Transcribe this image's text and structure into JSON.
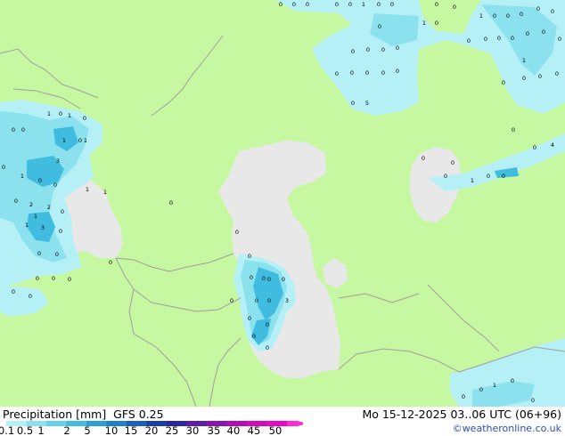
{
  "title": {
    "label": "Precipitation [mm]",
    "model": "GFS 0.25"
  },
  "datetime": "Mo 15-12-2025 03..06 UTC (06+96)",
  "credit": "©weatheronline.co.uk",
  "legend": {
    "ticks": [
      "0.1",
      "0.5",
      "1",
      "2",
      "5",
      "10",
      "15",
      "20",
      "25",
      "30",
      "35",
      "40",
      "45",
      "50"
    ],
    "colors": [
      "#b4f0f5",
      "#8be2ee",
      "#64d2e8",
      "#3fbcdf",
      "#2aa0d6",
      "#1e82c8",
      "#1a5fb8",
      "#1a3fa8",
      "#2e25a0",
      "#5c1ea8",
      "#8a14b0",
      "#b40cb4",
      "#d20cbe",
      "#e60ac8",
      "#ff28d2"
    ]
  },
  "colors": {
    "land": "#c6f7a1",
    "water": "#e8e8e8",
    "precip_light": "#b4f0f5",
    "precip_mid": "#8be2ee",
    "precip_heavy": "#3fbcdf",
    "border": "#a0a0a0"
  },
  "precip_values": [
    "0",
    "0",
    "0",
    "0",
    "0",
    "1",
    "0",
    "0",
    "0",
    "0",
    "1",
    "0",
    "0",
    "0",
    "0",
    "0",
    "0",
    "1",
    "0",
    "0",
    "0",
    "0",
    "0",
    "0",
    "0",
    "0",
    "0",
    "0",
    "0",
    "0",
    "0",
    "0",
    "0",
    "0",
    "0",
    "1",
    "0",
    "0",
    "0",
    "0",
    "1",
    "0",
    "1",
    "0",
    "0",
    "0",
    "3",
    "1",
    "0",
    "1",
    "0",
    "1",
    "0",
    "0",
    "1",
    "1",
    "2",
    "0",
    "1",
    "2",
    "0",
    "1",
    "3",
    "0",
    "0",
    "0",
    "0",
    "0",
    "0",
    "0",
    "0",
    "3",
    "0",
    "0",
    "0",
    "0",
    "5",
    "0",
    "0",
    "0",
    "4",
    "1",
    "0",
    "0",
    "0",
    "0",
    "0",
    "0",
    "0",
    "0",
    "0",
    "0",
    "0",
    "0",
    "1",
    "0",
    "0",
    "0",
    "0",
    "0",
    "0",
    "0",
    "0"
  ]
}
